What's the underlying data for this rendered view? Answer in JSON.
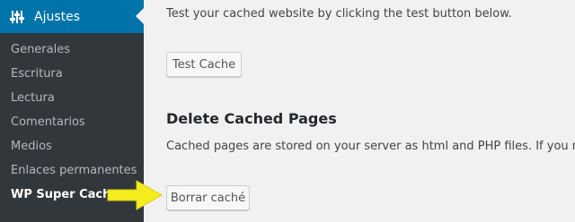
{
  "sidebar": {
    "top": {
      "label": "Ajustes",
      "icon": "settings-sliders-icon"
    },
    "items": [
      {
        "label": "Generales"
      },
      {
        "label": "Escritura"
      },
      {
        "label": "Lectura"
      },
      {
        "label": "Comentarios"
      },
      {
        "label": "Medios"
      },
      {
        "label": "Enlaces permanentes"
      },
      {
        "label": "WP Super Cache",
        "current": true
      }
    ]
  },
  "main": {
    "test_description": "Test your cached website by clicking the test button below.",
    "test_button_label": "Test Cache",
    "delete_heading": "Delete Cached Pages",
    "delete_description": "Cached pages are stored on your server as html and PHP files. If you need to delete them, use the button below.",
    "delete_button_label": "Borrar caché"
  },
  "annotation": {
    "icon": "yellow-arrow-icon",
    "color": "#f5ec1e"
  },
  "colors": {
    "sidebar_bg": "#32373c",
    "menu_active_bg": "#0073aa",
    "content_bg": "#f1f1f1"
  }
}
